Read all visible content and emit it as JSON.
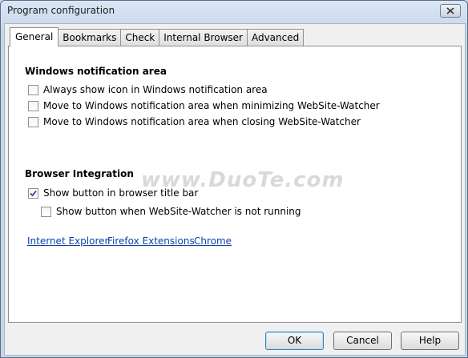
{
  "window": {
    "title": "Program configuration"
  },
  "tabs": [
    {
      "label": "General",
      "active": true
    },
    {
      "label": "Bookmarks",
      "active": false
    },
    {
      "label": "Check",
      "active": false
    },
    {
      "label": "Internal Browser",
      "active": false
    },
    {
      "label": "Advanced",
      "active": false
    }
  ],
  "notification_area": {
    "title": "Windows notification area",
    "options": [
      {
        "label": "Always show icon in Windows notification area",
        "checked": false
      },
      {
        "label": "Move to Windows notification area when minimizing WebSite-Watcher",
        "checked": false
      },
      {
        "label": "Move to Windows notification area when closing WebSite-Watcher",
        "checked": false
      }
    ]
  },
  "browser_integration": {
    "title": "Browser Integration",
    "options": [
      {
        "label": "Show button in browser title bar",
        "checked": true
      },
      {
        "label": "Show button when WebSite-Watcher is not running",
        "checked": false
      }
    ],
    "links": [
      "Internet Explorer",
      "Firefox Extensions",
      "Chrome"
    ]
  },
  "buttons": {
    "ok": "OK",
    "cancel": "Cancel",
    "help": "Help"
  },
  "watermark": "www.DuoTe.com"
}
